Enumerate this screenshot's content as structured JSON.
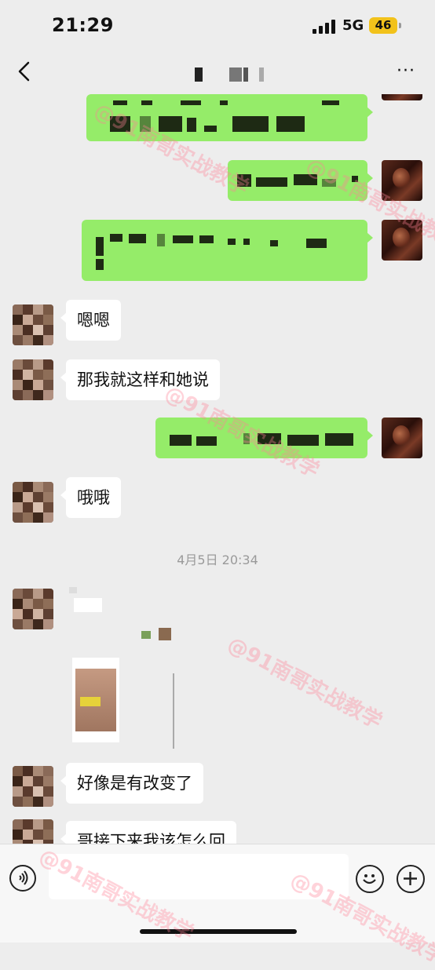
{
  "status": {
    "time": "21:29",
    "network": "5G",
    "battery": "46"
  },
  "nav": {
    "back_label": "<",
    "more_label": "···"
  },
  "messages": [
    {
      "side": "in",
      "text": "嗯嗯"
    },
    {
      "side": "in",
      "text": "那我就这样和她说"
    },
    {
      "side": "in",
      "text": "哦哦"
    },
    {
      "side": "in",
      "text": "好像是有改变了"
    },
    {
      "side": "in",
      "text": "哥接下来我该怎么回"
    }
  ],
  "time_divider": "4月5日 20:34",
  "watermark": "@91南哥实战教学",
  "colors": {
    "background": "#ededed",
    "bubble_out": "#95ec69",
    "bubble_in": "#ffffff",
    "battery": "#f2c21b"
  }
}
